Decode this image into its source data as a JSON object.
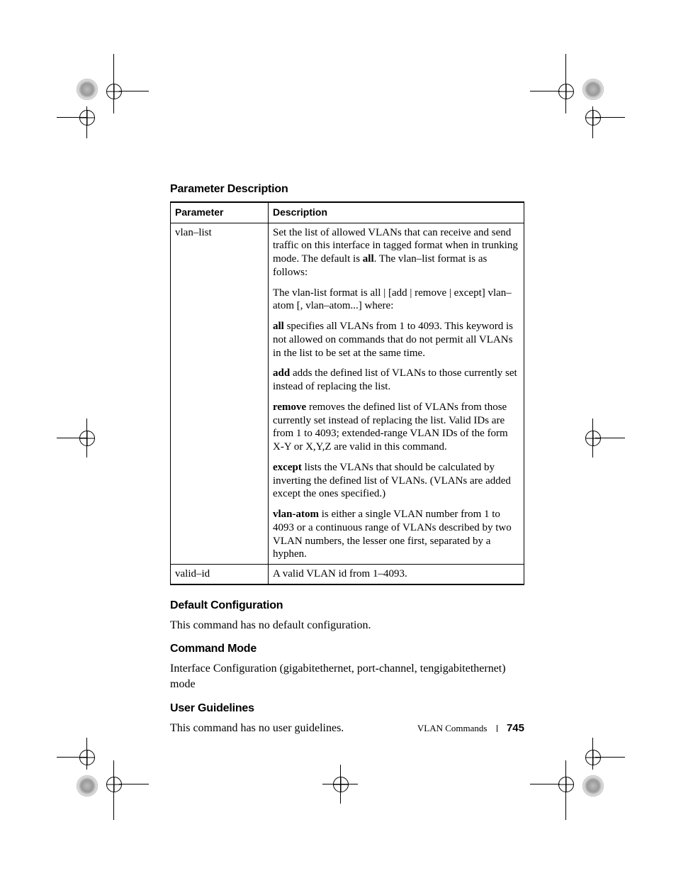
{
  "sections": {
    "param_heading": "Parameter Description",
    "default_heading": "Default Configuration",
    "default_text": "This command has no default configuration.",
    "mode_heading": "Command Mode",
    "mode_text": "Interface Configuration (gigabitethernet, port-channel, tengigabitethernet) mode",
    "guidelines_heading": "User Guidelines",
    "guidelines_text": "This command has no user guidelines."
  },
  "table": {
    "headers": {
      "param": "Parameter",
      "desc": "Description"
    },
    "rows": [
      {
        "param": "vlan–list",
        "desc_1_a": "Set the list of allowed VLANs that can receive and send traffic on this interface in tagged format when in trunking mode. The default is ",
        "desc_1_b": "all",
        "desc_1_c": ". The vlan–list format is as follows:",
        "desc_2": "The vlan-list format is all | [add | remove | except] vlan–atom [, vlan–atom...] where:",
        "desc_3_a": "all",
        "desc_3_b": " specifies all VLANs from 1 to 4093. This keyword is not allowed on commands that do not permit all VLANs in the list to be set at the same time.",
        "desc_4_a": "add",
        "desc_4_b": " adds the defined list of VLANs to those currently set instead of replacing the list.",
        "desc_5_a": "remove",
        "desc_5_b": " removes the defined list of VLANs from those currently set instead of replacing the list. Valid IDs are from 1 to 4093; extended-range VLAN IDs of the form X-Y or X,Y,Z are valid in this command.",
        "desc_6_a": "except",
        "desc_6_b": " lists the VLANs that should be calculated by inverting the defined list of VLANs. (VLANs are added except the ones specified.)",
        "desc_7_a": "vlan-atom",
        "desc_7_b": " is either a single VLAN number from 1 to 4093 or a continuous range of VLANs described by two VLAN numbers, the lesser one first, separated by a hyphen."
      },
      {
        "param": "valid–id",
        "desc": "A valid VLAN id from 1–4093."
      }
    ]
  },
  "footer": {
    "section": "VLAN Commands",
    "page": "745"
  }
}
